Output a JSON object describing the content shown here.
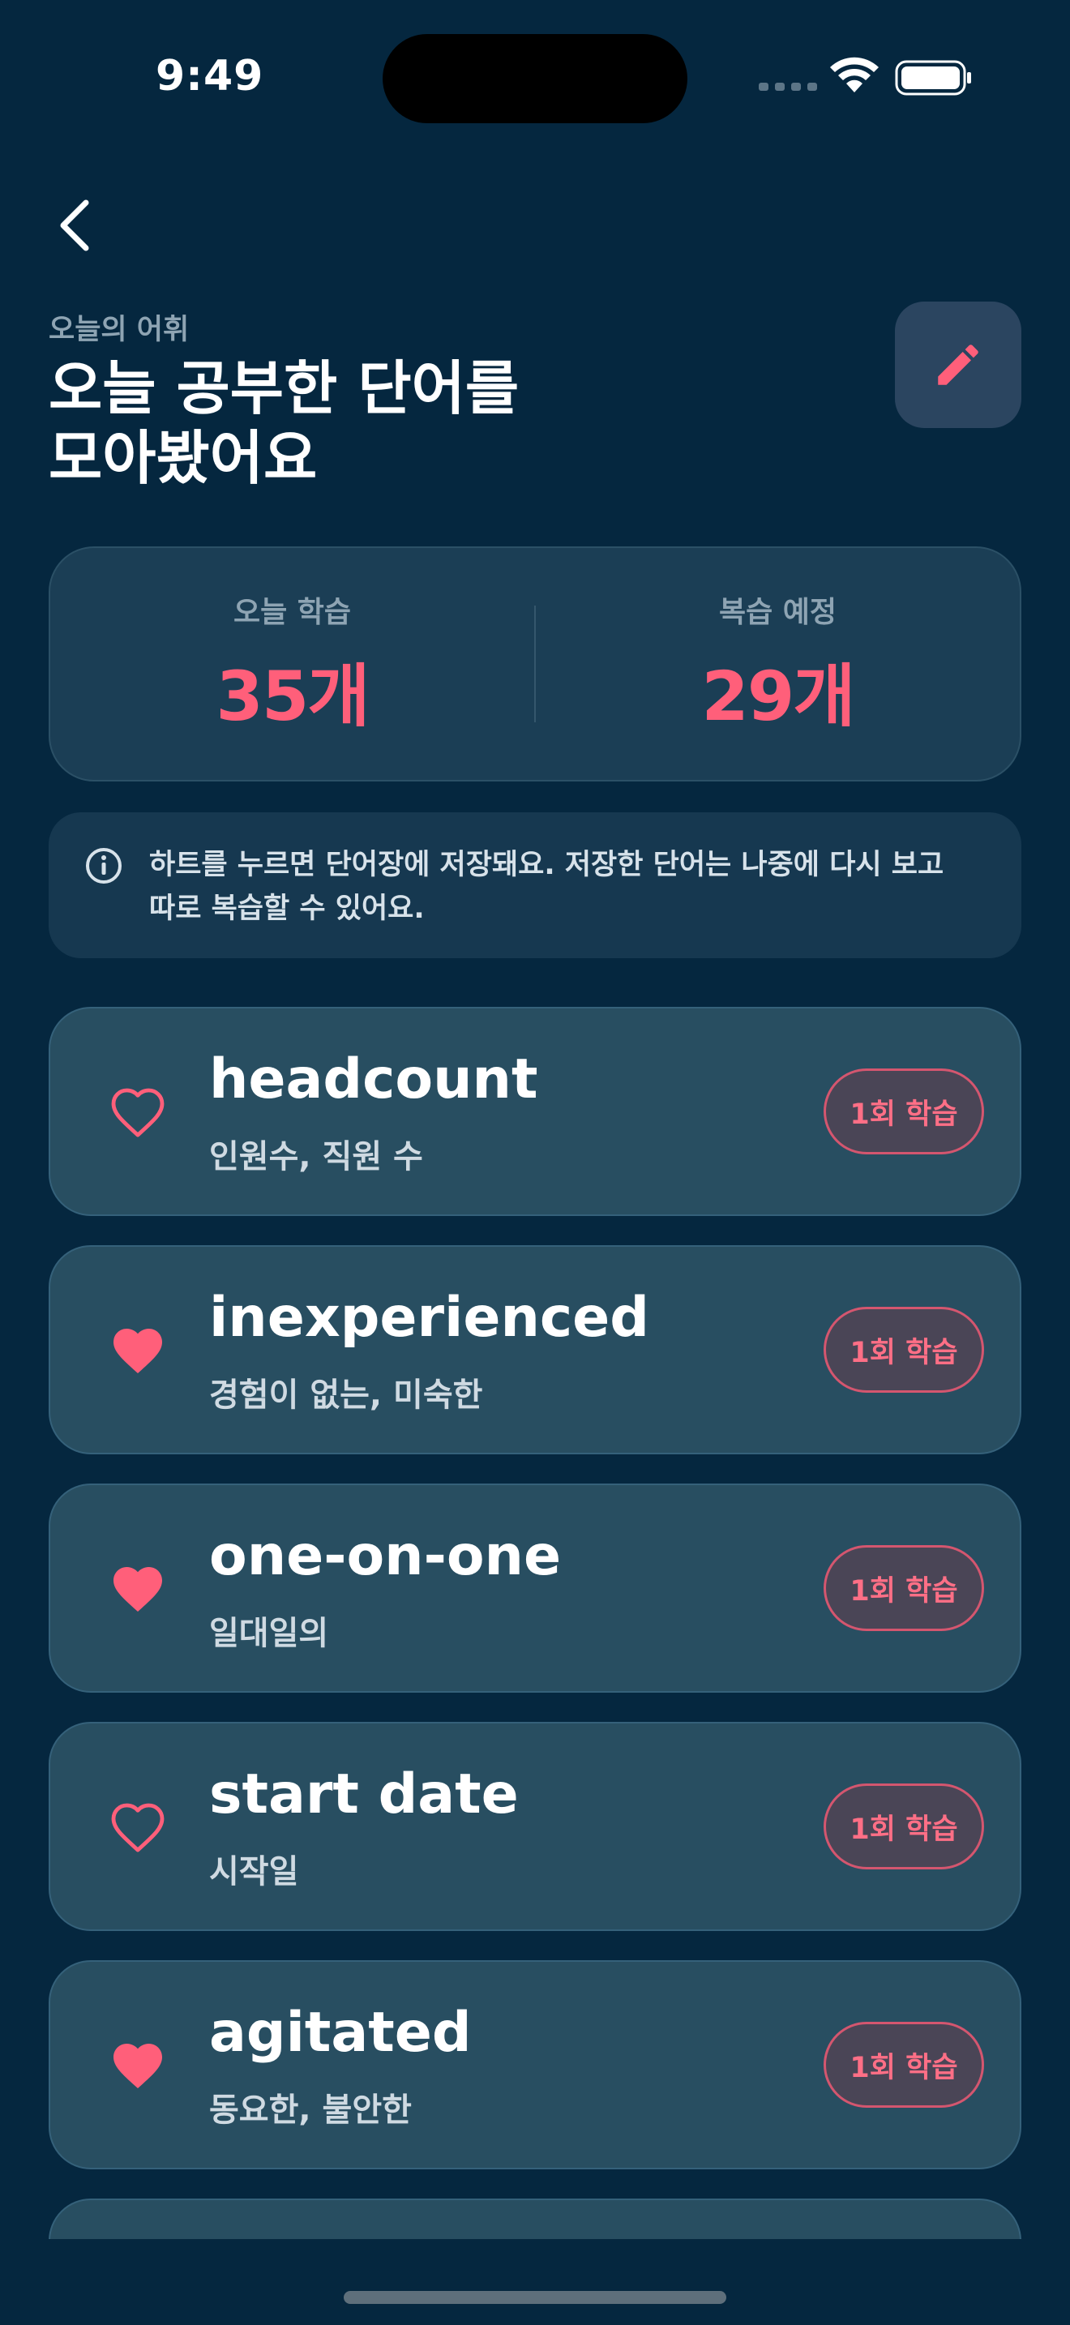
{
  "status_bar": {
    "time": "9:49"
  },
  "header": {
    "subtitle": "오늘의 어휘",
    "title_line1": "오늘 공부한 단어를",
    "title_line2": "모아봤어요"
  },
  "stats": {
    "today_label": "오늘 학습",
    "today_value": "35개",
    "review_label": "복습 예정",
    "review_value": "29개"
  },
  "info": {
    "line1": "하트를 누르면 단어장에 저장돼요. 저장한 단어는 나중에 다시 보고",
    "line2": "따로 복습할 수 있어요."
  },
  "words": [
    {
      "word": "headcount",
      "meaning": "인원수, 직원 수",
      "badge": "1회 학습",
      "favorited": false
    },
    {
      "word": "inexperienced",
      "meaning": "경험이 없는, 미숙한",
      "badge": "1회 학습",
      "favorited": true
    },
    {
      "word": "one-on-one",
      "meaning": "일대일의",
      "badge": "1회 학습",
      "favorited": true
    },
    {
      "word": "start date",
      "meaning": "시작일",
      "badge": "1회 학습",
      "favorited": false
    },
    {
      "word": "agitated",
      "meaning": "동요한, 불안한",
      "badge": "1회 학습",
      "favorited": true
    }
  ],
  "colors": {
    "background": "#05273f",
    "accent": "#ff5f7a",
    "card": "#284e61"
  },
  "icons": {
    "back": "chevron-left-icon",
    "edit": "pencil-icon",
    "info": "info-circle-icon",
    "favorite_on": "heart-filled-icon",
    "favorite_off": "heart-outline-icon"
  }
}
